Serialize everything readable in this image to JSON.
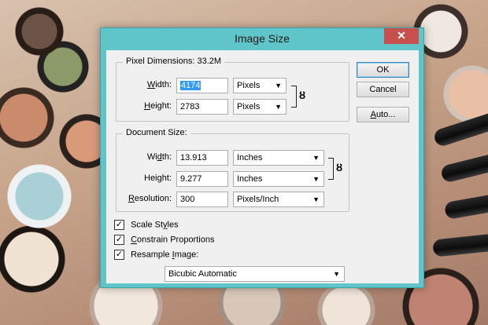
{
  "dialog": {
    "title": "Image Size",
    "close_glyph": "✕"
  },
  "pixel_dimensions": {
    "legend": "Pixel Dimensions:",
    "size": "33.2M",
    "width_label_pre": "W",
    "width_label_post": "idth:",
    "width_value": "4174",
    "width_unit": "Pixels",
    "height_label_pre": "H",
    "height_label_post": "eight:",
    "height_value": "2783",
    "height_unit": "Pixels"
  },
  "document_size": {
    "legend": "Document Size:",
    "width_label_pre": "Wi",
    "width_label_u": "d",
    "width_label_post": "th:",
    "width_value": "13.913",
    "width_unit": "Inches",
    "height_label_pre": "Hei",
    "height_label_u": "g",
    "height_label_post": "ht:",
    "height_value": "9.277",
    "height_unit": "Inches",
    "resolution_label_u": "R",
    "resolution_label_post": "esolution:",
    "resolution_value": "300",
    "resolution_unit": "Pixels/Inch"
  },
  "buttons": {
    "ok": "OK",
    "cancel": "Cancel",
    "auto_u": "A",
    "auto_post": "uto..."
  },
  "options": {
    "scale_styles_pre": "Scale St",
    "scale_styles_u": "y",
    "scale_styles_post": "les",
    "scale_styles_checked": true,
    "constrain_u": "C",
    "constrain_post": "onstrain Proportions",
    "constrain_checked": true,
    "resample_pre": "Resample ",
    "resample_u": "I",
    "resample_post": "mage:",
    "resample_checked": true,
    "resample_method": "Bicubic Automatic"
  },
  "icons": {
    "link": "link-icon",
    "dropdown": "chevron-down-icon",
    "check": "✓"
  }
}
